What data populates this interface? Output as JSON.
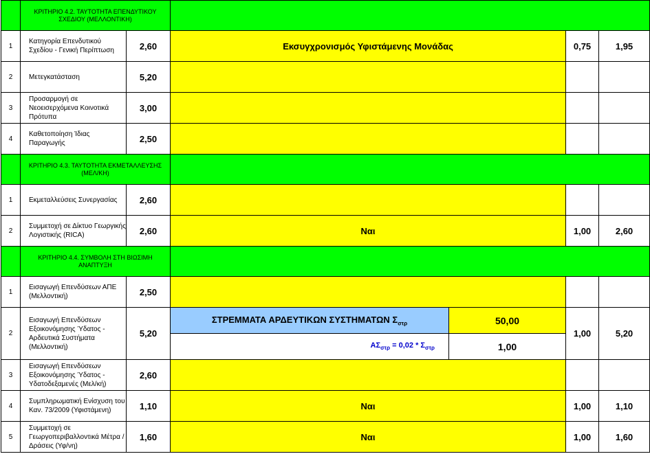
{
  "sections": {
    "s42": {
      "title": "ΚΡΙΤΗΡΙΟ 4.2. ΤΑΥΤΟΤΗΤΑ ΕΠΕΝΔΥΤΙΚΟΥ ΣΧΕΔΙΟΥ (ΜΕΛΛΟΝΤΙΚΗ)"
    },
    "s43": {
      "title": "ΚΡΙΤΗΡΙΟ 4.3. ΤΑΥΤΟΤΗΤΑ ΕΚΜΕΤΑΛΛΕΥΣΗΣ (ΜΕΛ/ΚΗ)"
    },
    "s44": {
      "title": "ΚΡΙΤΗΡΙΟ 4.4. ΣΥΜΒΟΛΗ ΣΤΗ ΒΙΩΣΙΜΗ ΑΝΑΠΤΥΞΗ"
    }
  },
  "rows": {
    "r1": {
      "num": "1",
      "label": "Κατηγορία Επενδυτικού Σχεδίου - Γενική Περίπτωση",
      "score": "2,60",
      "answer": "Εκσυγχρονισμός Υφιστάμενης Μονάδας",
      "w": "0,75",
      "total": "1,95"
    },
    "r2": {
      "num": "2",
      "label": "Μετεγκατάσταση",
      "score": "5,20"
    },
    "r3": {
      "num": "3",
      "label": "Προσαρμογή σε Νεοεισερχόμενα Κοινοτικά Πρότυπα",
      "score": "3,00"
    },
    "r4": {
      "num": "4",
      "label": "Καθετοποίηση Ίδιας Παραγωγής",
      "score": "2,50"
    },
    "r5": {
      "num": "1",
      "label": "Εκμεταλλεύσεις Συνεργασίας",
      "score": "2,60"
    },
    "r6": {
      "num": "2",
      "label": "Συμμετοχή σε Δίκτυο Γεωργικής Λογιστικής (RICA)",
      "score": "2,60",
      "answer": "Ναι",
      "w": "1,00",
      "total": "2,60"
    },
    "r7": {
      "num": "1",
      "label": "Εισαγωγή Επενδύσεων ΑΠΕ (Μελλοντική)",
      "score": "2,50"
    },
    "r8": {
      "num": "2",
      "label": "Εισαγωγή Επενδύσεων Εξοικονόμησης Ύδατος - Αρδευτικά Συστήματα (Μελλοντική)",
      "score": "5,20",
      "w": "1,00",
      "total": "5,20",
      "strem_label": "ΣΤΡΕΜΜΑΤΑ ΑΡΔΕΥΤΙΚΩΝ ΣΥΣΤΗΜΑΤΩΝ Σ",
      "strem_sub": "στρ",
      "strem_value": "50,00",
      "formula_a": "ΑΣ",
      "formula_sub1": "στρ",
      "formula_b": " = 0,02 * Σ",
      "formula_sub2": "στρ",
      "formula_value": "1,00"
    },
    "r9": {
      "num": "3",
      "label": "Εισαγωγή Επενδύσεων Εξοικονόμησης Ύδατος - Υδατοδεξαμενές (Μελ/κή)",
      "score": "2,60"
    },
    "r10": {
      "num": "4",
      "label": "Συμπληρωματική Ενίσχυση του Καν. 73/2009 (Υφιστάμενη)",
      "score": "1,10",
      "answer": "Ναι",
      "w": "1,00",
      "total": "1,10"
    },
    "r11": {
      "num": "5",
      "label": "Συμμετοχή σε Γεωργοπεριβαλλοντικά Μέτρα / Δράσεις (Υφ/νη)",
      "score": "1,60",
      "answer": "Ναι",
      "w": "1,00",
      "total": "1,60"
    }
  }
}
